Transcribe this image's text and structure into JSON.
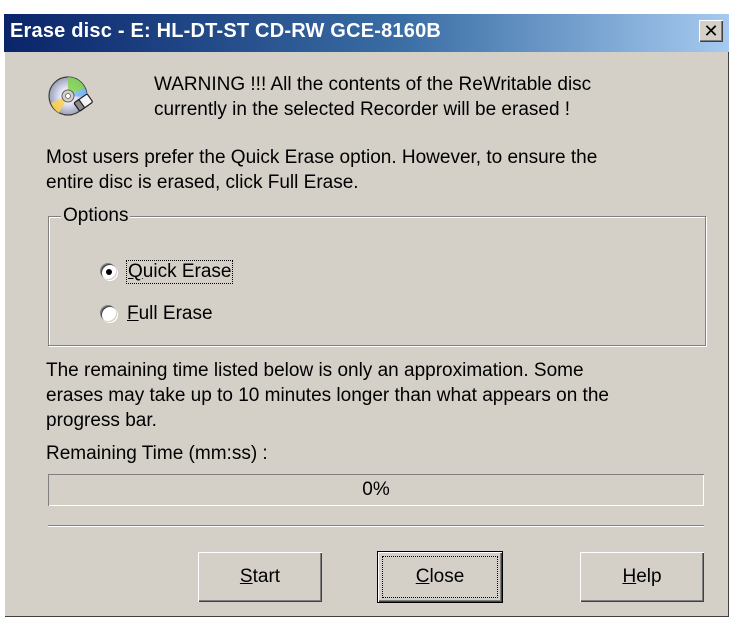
{
  "window": {
    "title": "Erase disc - E: HL-DT-ST CD-RW GCE-8160B",
    "close_glyph": "✕"
  },
  "warning": {
    "line1": "WARNING !!! All the contents of the ReWritable disc",
    "line2": "currently in the selected Recorder will be erased !",
    "icon": "cd-eraser-icon"
  },
  "intro": {
    "line1": "Most users prefer the Quick Erase option. However, to ensure the",
    "line2": "entire disc is erased, click Full Erase."
  },
  "options": {
    "legend": "Options",
    "quick": {
      "hotkey": "Q",
      "rest": "uick Erase",
      "checked": true
    },
    "full": {
      "hotkey": "F",
      "rest": "ull Erase",
      "checked": false
    }
  },
  "approximation": {
    "line1": "The remaining time listed below is only an approximation. Some",
    "line2": "erases may take up to 10 minutes longer than what appears on the",
    "line3": "progress bar."
  },
  "remaining_time_label": "Remaining Time (mm:ss) :",
  "progress": {
    "text": "0%",
    "value": 0
  },
  "buttons": {
    "start": {
      "hotkey": "S",
      "rest": "tart"
    },
    "close": {
      "hotkey": "C",
      "rest": "lose"
    },
    "help": {
      "hotkey": "H",
      "rest": "elp"
    }
  }
}
